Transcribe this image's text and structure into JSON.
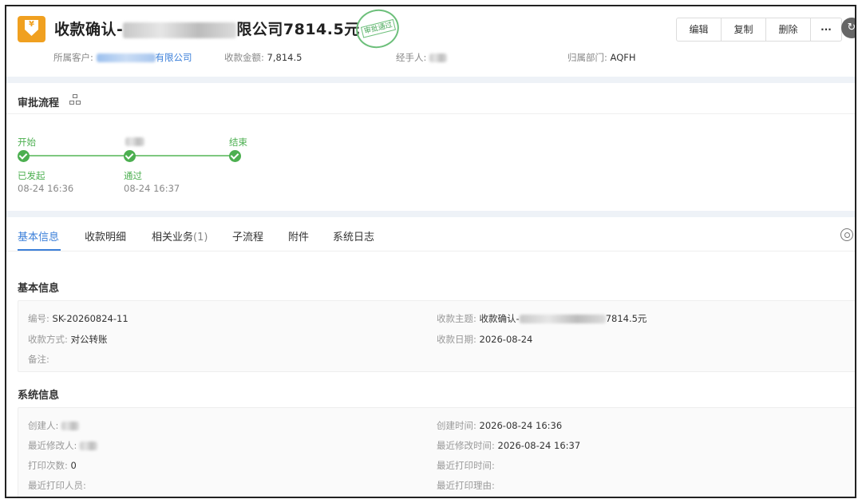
{
  "header": {
    "title_prefix": "收款确认-",
    "title_suffix": "限公司7814.5元",
    "stamp_text": "审批通过",
    "customer_label": "所属客户:",
    "customer_value_suffix": "有限公司",
    "amount_label": "收款金额:",
    "amount_value": "7,814.5",
    "handler_label": "经手人:",
    "dept_label": "归属部门:",
    "dept_value": "AQFH",
    "buttons": [
      "编辑",
      "复制",
      "删除",
      "···"
    ]
  },
  "approval": {
    "section_title": "审批流程",
    "nodes": [
      {
        "name": "开始",
        "status": "已发起",
        "time": "08-24 16:36"
      },
      {
        "name": "",
        "status": "通过",
        "time": "08-24 16:37"
      },
      {
        "name": "结束",
        "status": "",
        "time": ""
      }
    ]
  },
  "tabs": [
    {
      "label": "基本信息",
      "count": ""
    },
    {
      "label": "收款明细",
      "count": ""
    },
    {
      "label": "相关业务",
      "count": "(1)"
    },
    {
      "label": "子流程",
      "count": ""
    },
    {
      "label": "附件",
      "count": ""
    },
    {
      "label": "系统日志",
      "count": ""
    }
  ],
  "basic_info": {
    "section_title": "基本信息",
    "number_label": "编号:",
    "number_value": "SK-20260824-11",
    "subject_label": "收款主题:",
    "subject_prefix": "收款确认-",
    "subject_suffix": "7814.5元",
    "method_label": "收款方式:",
    "method_value": "对公转账",
    "date_label": "收款日期:",
    "date_value": "2026-08-24",
    "remark_label": "备注:"
  },
  "system_info": {
    "section_title": "系统信息",
    "creator_label": "创建人:",
    "created_time_label": "创建时间:",
    "created_time_value": "2026-08-24 16:36",
    "modifier_label": "最近修改人:",
    "modified_time_label": "最近修改时间:",
    "modified_time_value": "2026-08-24 16:37",
    "print_count_label": "打印次数:",
    "print_count_value": "0",
    "last_print_time_label": "最近打印时间:",
    "last_printer_label": "最近打印人员:",
    "last_print_reason_label": "最近打印理由:"
  }
}
